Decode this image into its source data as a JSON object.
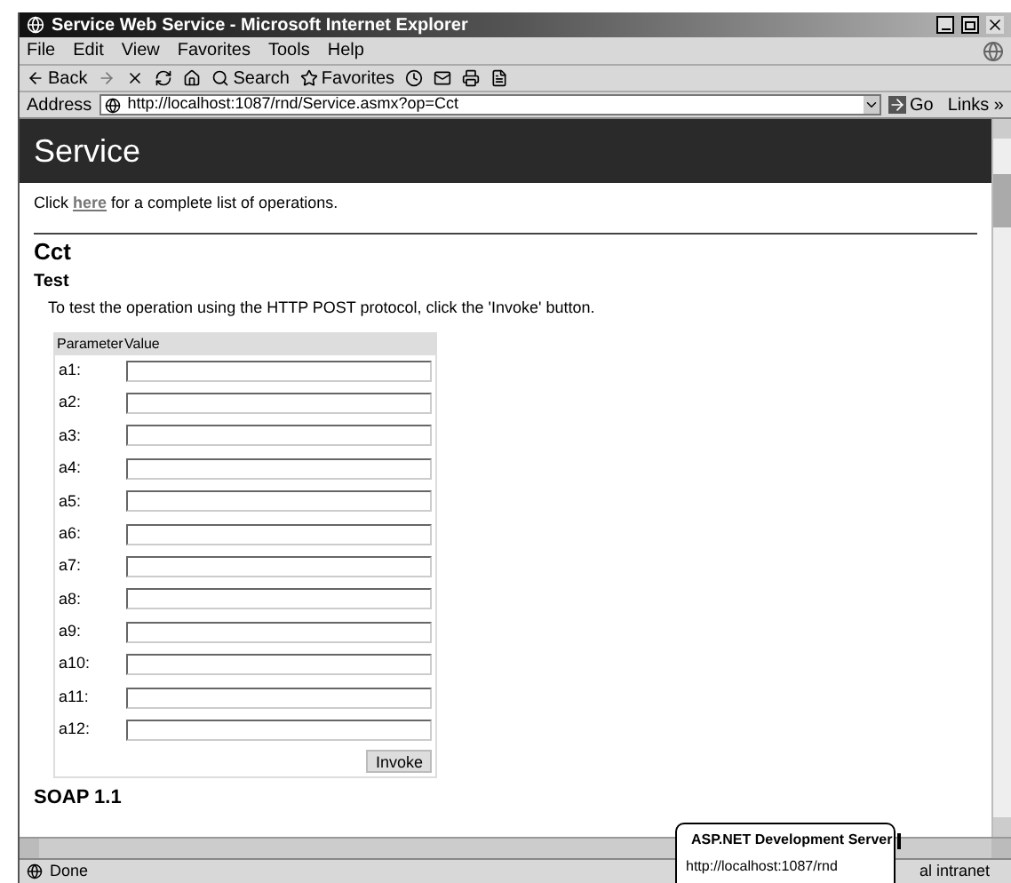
{
  "window": {
    "title": "Service Web Service - Microsoft Internet Explorer"
  },
  "menu": [
    "File",
    "Edit",
    "View",
    "Favorites",
    "Tools",
    "Help"
  ],
  "toolbar": {
    "back": "Back",
    "search": "Search",
    "favorites": "Favorites"
  },
  "address_bar": {
    "label": "Address",
    "url": "http://localhost:1087/rnd/Service.asmx?op=Cct",
    "go": "Go",
    "links": "Links »"
  },
  "page": {
    "header": "Service",
    "intro": {
      "before": "Click ",
      "link": "here",
      "after": " for a complete list of operations."
    },
    "operation": "Cct",
    "section": "Test",
    "instructions": "To test the operation using the HTTP POST protocol, click the 'Invoke' button.",
    "table": {
      "columns": [
        "Parameter",
        "Value"
      ],
      "rows": [
        {
          "parameter": "a1:"
        },
        {
          "parameter": "a2:"
        },
        {
          "parameter": "a3:"
        },
        {
          "parameter": "a4:"
        },
        {
          "parameter": "a5:"
        },
        {
          "parameter": "a6:"
        },
        {
          "parameter": "a7:"
        },
        {
          "parameter": "a8:"
        },
        {
          "parameter": "a9:"
        },
        {
          "parameter": "a10:"
        },
        {
          "parameter": "a11:"
        },
        {
          "parameter": "a12:"
        }
      ]
    },
    "invoke": "Invoke",
    "next_section": "SOAP 1.1"
  },
  "status_bar": {
    "status": "Done",
    "zone": "al intranet"
  },
  "balloon": {
    "title": "ASP.NET Development Server",
    "text": "http://localhost:1087/rnd"
  }
}
